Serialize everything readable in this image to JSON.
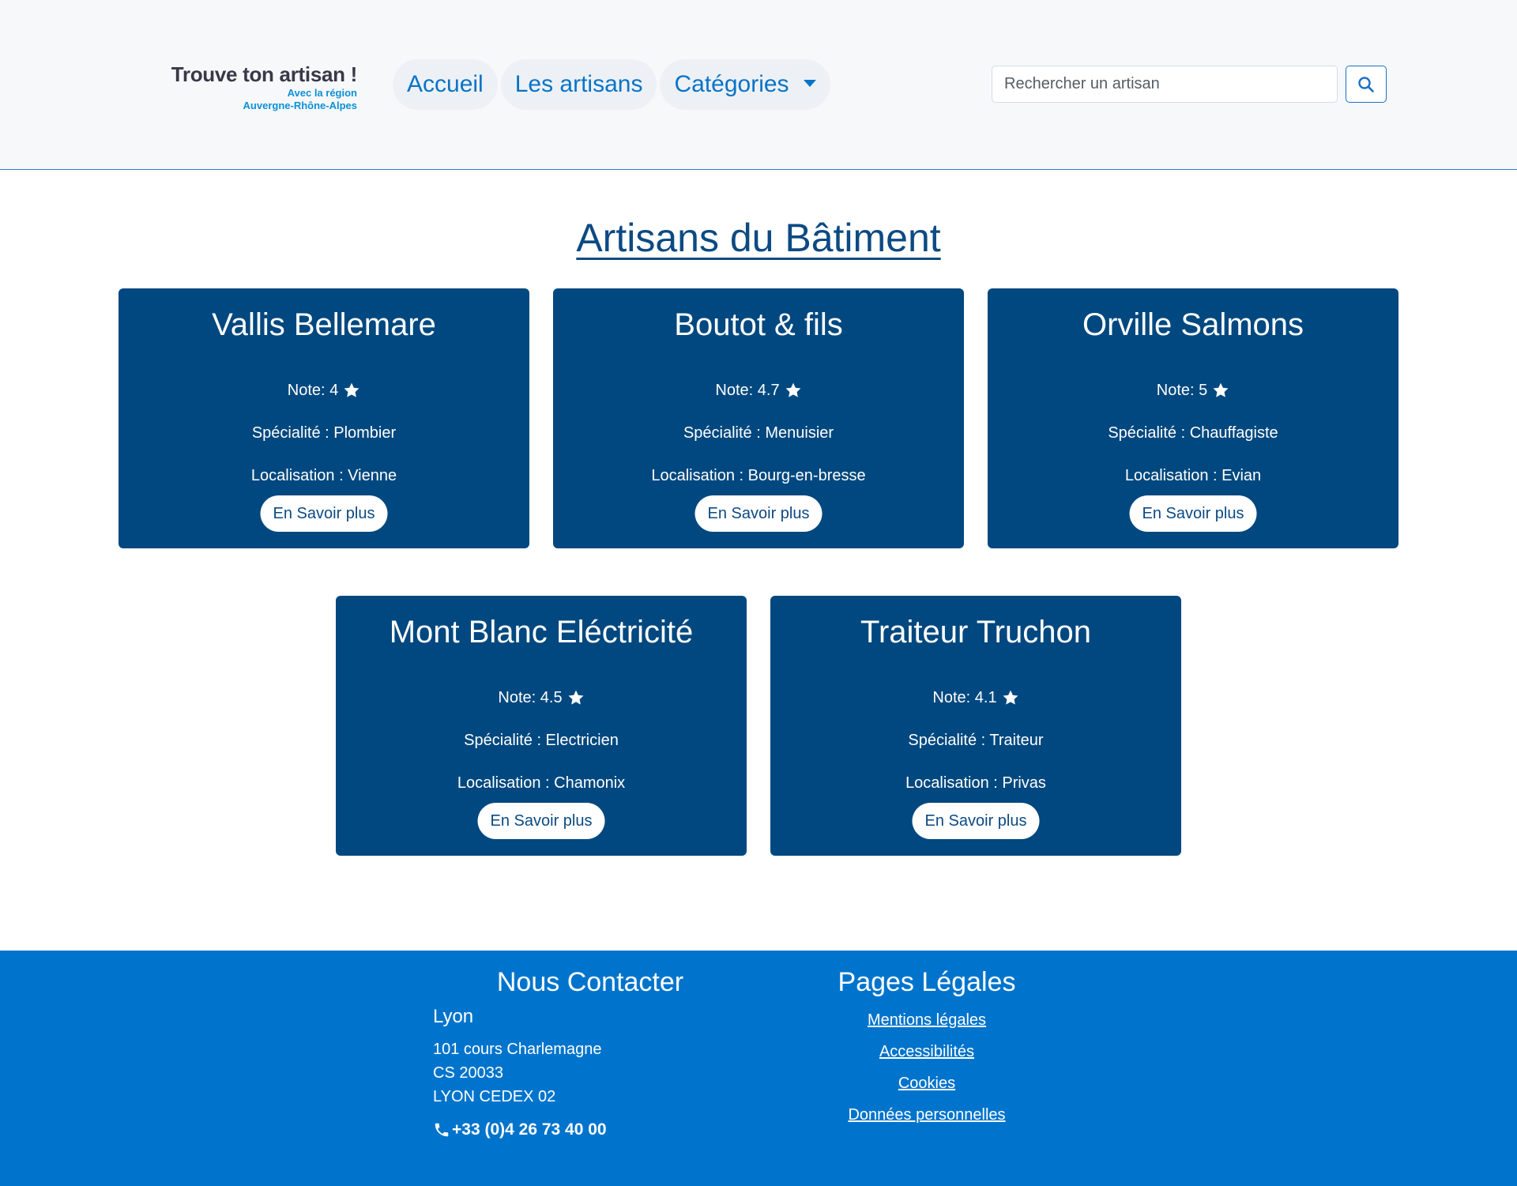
{
  "header": {
    "logo": {
      "title": "Trouve ton artisan !",
      "sub1": "Avec la région",
      "sub2": "Auvergne-Rhône-Alpes"
    },
    "nav": [
      {
        "label": "Accueil"
      },
      {
        "label": "Les artisans"
      },
      {
        "label": "Catégories"
      }
    ],
    "search": {
      "placeholder": "Rechercher un artisan",
      "value": ""
    }
  },
  "main": {
    "title": "Artisans du Bâtiment",
    "cards": [
      {
        "name": "Vallis Bellemare",
        "note_label": "Note: 4",
        "rating": 4,
        "specialty": "Spécialité : Plombier",
        "location": "Localisation : Vienne",
        "button": "En Savoir plus"
      },
      {
        "name": "Boutot & fils",
        "note_label": "Note: 4.7",
        "rating": 4.7,
        "specialty": "Spécialité : Menuisier",
        "location": "Localisation : Bourg-en-bresse",
        "button": "En Savoir plus"
      },
      {
        "name": "Orville Salmons",
        "note_label": "Note: 5",
        "rating": 5,
        "specialty": "Spécialité : Chauffagiste",
        "location": "Localisation : Evian",
        "button": "En Savoir plus"
      },
      {
        "name": "Mont Blanc Eléctricité",
        "note_label": "Note: 4.5",
        "rating": 4.5,
        "specialty": "Spécialité : Electricien",
        "location": "Localisation : Chamonix",
        "button": "En Savoir plus"
      },
      {
        "name": "Traiteur Truchon",
        "note_label": "Note: 4.1",
        "rating": 4.1,
        "specialty": "Spécialité : Traiteur",
        "location": "Localisation : Privas",
        "button": "En Savoir plus"
      }
    ]
  },
  "footer": {
    "contact": {
      "heading": "Nous Contacter",
      "city": "Lyon",
      "address": [
        "101 cours Charlemagne",
        "CS 20033",
        "LYON CEDEX 02"
      ],
      "phone": "+33 (0)4 26 73 40 00"
    },
    "legal": {
      "heading": "Pages Légales",
      "links": [
        "Mentions légales",
        "Accessibilités",
        "Cookies",
        "Données personnelles"
      ]
    }
  },
  "colors": {
    "header_bg": "#f7f8fa",
    "nav_text": "#0973c7",
    "card_bg": "#00487f",
    "title_text": "#0c4a82",
    "footer_bg": "#0074cc"
  },
  "icons": {
    "search": "search-icon",
    "star": "star-icon",
    "phone": "phone-icon",
    "caret": "chevron-down-icon"
  }
}
